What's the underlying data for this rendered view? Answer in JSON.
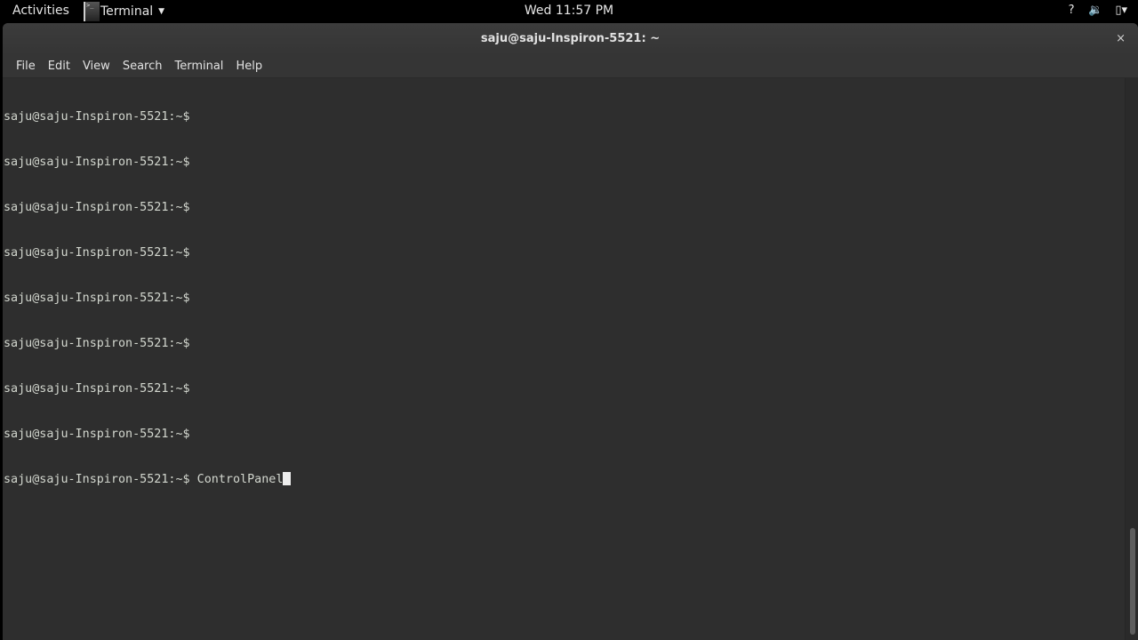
{
  "topbar": {
    "activities": "Activities",
    "app_name": "Terminal",
    "clock": "Wed 11:57 PM",
    "status_icons": [
      "help-icon",
      "volume-icon",
      "battery-icon",
      "power-menu-icon"
    ],
    "help_glyph": "?",
    "volume_glyph": "🔉",
    "battery_glyph": "▯",
    "menu_glyph": "▾"
  },
  "window": {
    "title": "saju@saju-Inspiron-5521: ~",
    "close_glyph": "×"
  },
  "menubar": {
    "items": [
      "File",
      "Edit",
      "View",
      "Search",
      "Terminal",
      "Help"
    ]
  },
  "terminal": {
    "prompt": "saju@saju-Inspiron-5521:~$",
    "lines": [
      "saju@saju-Inspiron-5521:~$",
      "saju@saju-Inspiron-5521:~$",
      "saju@saju-Inspiron-5521:~$",
      "saju@saju-Inspiron-5521:~$",
      "saju@saju-Inspiron-5521:~$",
      "saju@saju-Inspiron-5521:~$",
      "saju@saju-Inspiron-5521:~$",
      "saju@saju-Inspiron-5521:~$"
    ],
    "current_input": "ControlPanel"
  }
}
